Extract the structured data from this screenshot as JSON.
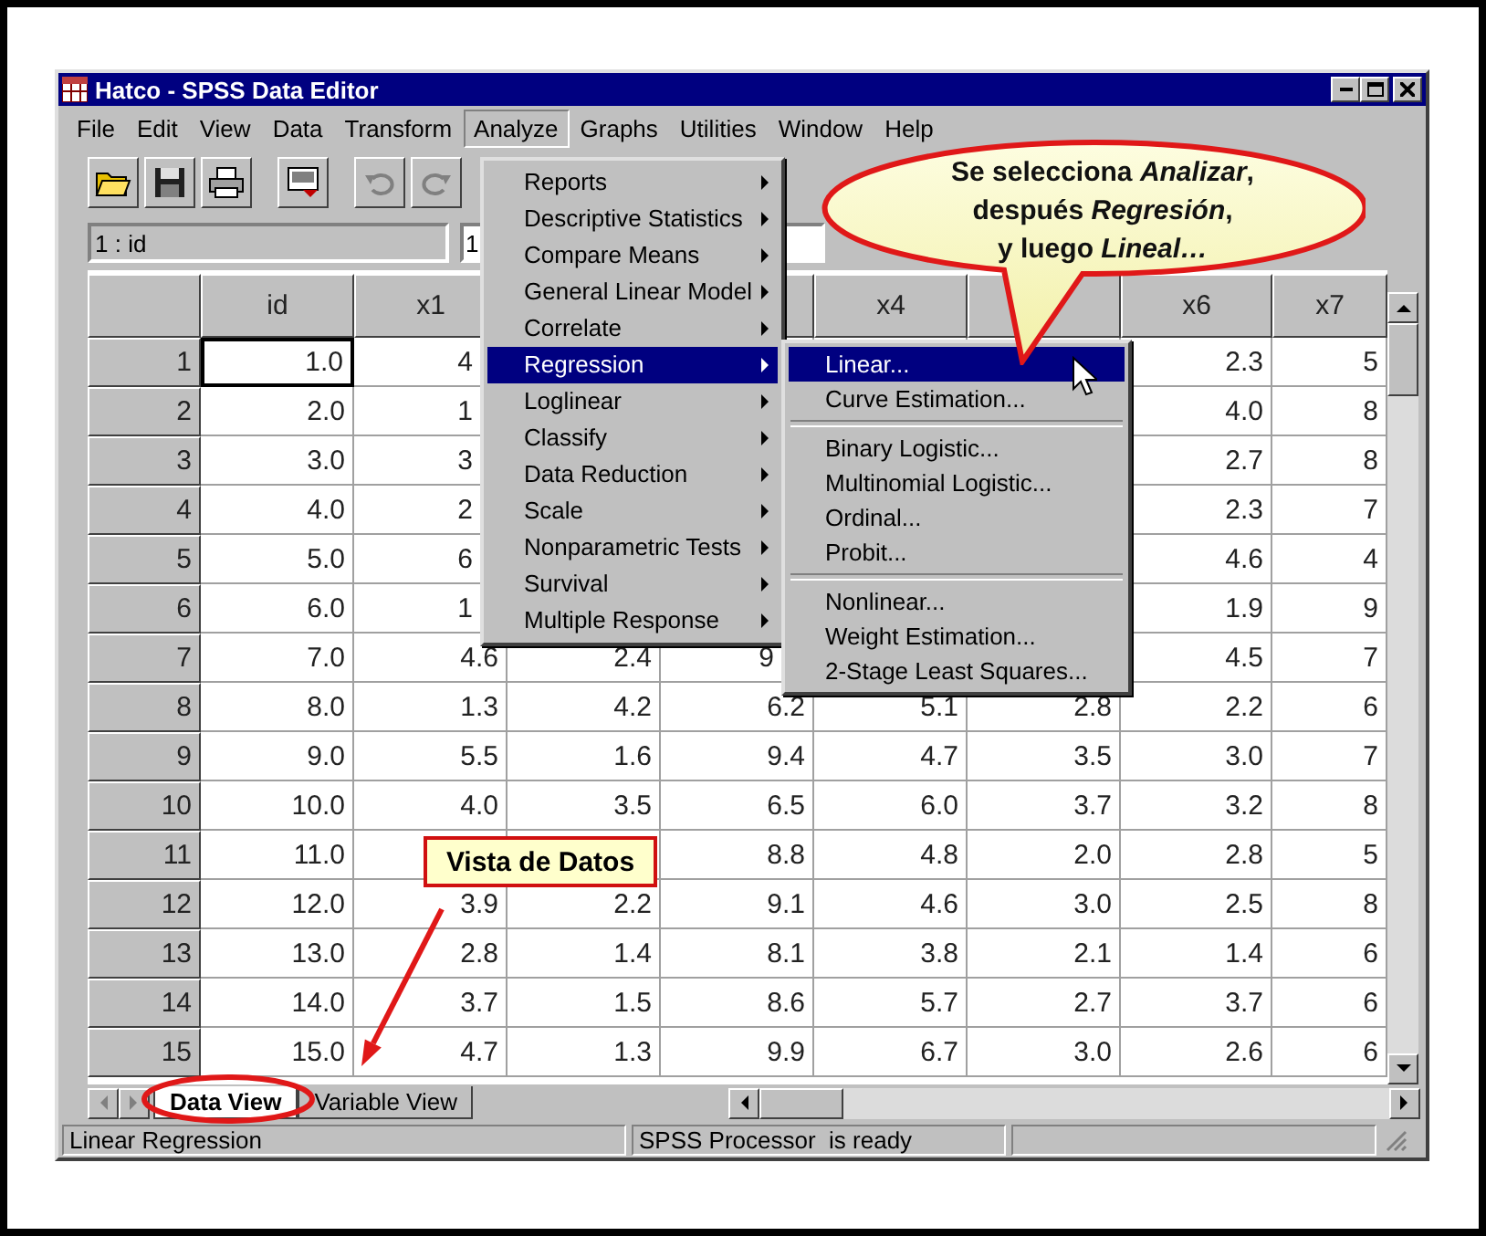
{
  "window": {
    "title": "Hatco - SPSS Data Editor"
  },
  "menu_bar": [
    {
      "label": "File",
      "selected": false
    },
    {
      "label": "Edit",
      "selected": false
    },
    {
      "label": "View",
      "selected": false
    },
    {
      "label": "Data",
      "selected": false
    },
    {
      "label": "Transform",
      "selected": false
    },
    {
      "label": "Analyze",
      "selected": true
    },
    {
      "label": "Graphs",
      "selected": false
    },
    {
      "label": "Utilities",
      "selected": false
    },
    {
      "label": "Window",
      "selected": false
    },
    {
      "label": "Help",
      "selected": false
    }
  ],
  "cell_reference": {
    "name": "1 : id",
    "value": "1"
  },
  "table": {
    "columns": {
      "column_1": "id",
      "column_2": "x1",
      "column_5": "x4",
      "column_7": "x6",
      "column_8": "x7"
    },
    "rows": [
      {
        "number": "1",
        "column_1": "1.0",
        "column_2": "4",
        "column_7": "2.3",
        "column_8": "5"
      },
      {
        "number": "2",
        "column_1": "2.0",
        "column_2": "1",
        "column_7": "4.0",
        "column_8": "8"
      },
      {
        "number": "3",
        "column_1": "3.0",
        "column_2": "3",
        "column_7": "2.7",
        "column_8": "8"
      },
      {
        "number": "4",
        "column_1": "4.0",
        "column_2": "2",
        "column_7": "2.3",
        "column_8": "7"
      },
      {
        "number": "5",
        "column_1": "5.0",
        "column_2": "6",
        "column_7": "4.6",
        "column_8": "4"
      },
      {
        "number": "6",
        "column_1": "6.0",
        "column_2": "1",
        "column_7": "1.9",
        "column_8": "9"
      },
      {
        "number": "7",
        "column_1": "7.0",
        "column_2": "4.6",
        "column_3": "2.4",
        "column_4": "9",
        "column_7": "4.5",
        "column_8": "7"
      },
      {
        "number": "8",
        "column_1": "8.0",
        "column_2": "1.3",
        "column_3": "4.2",
        "column_4": "6.2",
        "column_5": "5.1",
        "column_6": "2.8",
        "column_7": "2.2",
        "column_8": "6"
      },
      {
        "number": "9",
        "column_1": "9.0",
        "column_2": "5.5",
        "column_3": "1.6",
        "column_4": "9.4",
        "column_5": "4.7",
        "column_6": "3.5",
        "column_7": "3.0",
        "column_8": "7"
      },
      {
        "number": "10",
        "column_1": "10.0",
        "column_2": "4.0",
        "column_3": "3.5",
        "column_4": "6.5",
        "column_5": "6.0",
        "column_6": "3.7",
        "column_7": "3.2",
        "column_8": "8"
      },
      {
        "number": "11",
        "column_1": "11.0",
        "column_4": "8.8",
        "column_5": "4.8",
        "column_6": "2.0",
        "column_7": "2.8",
        "column_8": "5"
      },
      {
        "number": "12",
        "column_1": "12.0",
        "column_2": "3.9",
        "column_3": "2.2",
        "column_4": "9.1",
        "column_5": "4.6",
        "column_6": "3.0",
        "column_7": "2.5",
        "column_8": "8"
      },
      {
        "number": "13",
        "column_1": "13.0",
        "column_2": "2.8",
        "column_3": "1.4",
        "column_4": "8.1",
        "column_5": "3.8",
        "column_6": "2.1",
        "column_7": "1.4",
        "column_8": "6"
      },
      {
        "number": "14",
        "column_1": "14.0",
        "column_2": "3.7",
        "column_3": "1.5",
        "column_4": "8.6",
        "column_5": "5.7",
        "column_6": "2.7",
        "column_7": "3.7",
        "column_8": "6"
      },
      {
        "number": "15",
        "column_1": "15.0",
        "column_2": "4.7",
        "column_3": "1.3",
        "column_4": "9.9",
        "column_5": "6.7",
        "column_6": "3.0",
        "column_7": "2.6",
        "column_8": "6"
      }
    ]
  },
  "analyze_menu": [
    {
      "label": "Reports",
      "has_submenu": true,
      "selected": false
    },
    {
      "label": "Descriptive Statistics",
      "has_submenu": true,
      "selected": false
    },
    {
      "label": "Compare Means",
      "has_submenu": true,
      "selected": false
    },
    {
      "label": "General Linear Model",
      "has_submenu": true,
      "selected": false
    },
    {
      "label": "Correlate",
      "has_submenu": true,
      "selected": false
    },
    {
      "label": "Regression",
      "has_submenu": true,
      "selected": true
    },
    {
      "label": "Loglinear",
      "has_submenu": true,
      "selected": false
    },
    {
      "label": "Classify",
      "has_submenu": true,
      "selected": false
    },
    {
      "label": "Data Reduction",
      "has_submenu": true,
      "selected": false
    },
    {
      "label": "Scale",
      "has_submenu": true,
      "selected": false
    },
    {
      "label": "Nonparametric Tests",
      "has_submenu": true,
      "selected": false
    },
    {
      "label": "Survival",
      "has_submenu": true,
      "selected": false
    },
    {
      "label": "Multiple Response",
      "has_submenu": true,
      "selected": false
    }
  ],
  "regression_submenu": [
    [
      {
        "label": "Linear...",
        "selected": true
      },
      {
        "label": "Curve Estimation...",
        "selected": false
      }
    ],
    [
      {
        "label": "Binary Logistic...",
        "selected": false
      },
      {
        "label": "Multinomial Logistic...",
        "selected": false
      },
      {
        "label": "Ordinal...",
        "selected": false
      },
      {
        "label": "Probit...",
        "selected": false
      }
    ],
    [
      {
        "label": "Nonlinear...",
        "selected": false
      },
      {
        "label": "Weight Estimation...",
        "selected": false
      },
      {
        "label": "2-Stage Least Squares...",
        "selected": false
      }
    ]
  ],
  "sheet_tabs": [
    {
      "label": "Data View",
      "selected": true
    },
    {
      "label": "Variable View",
      "selected": false
    }
  ],
  "status_bar": {
    "message": "Linear Regression",
    "processor": "SPSS Processor  is ready"
  },
  "annotations": {
    "balloon": [
      "Se selecciona *Analizar*,",
      "después *Regresión*,",
      "y luego *Lineal…*"
    ],
    "label": "Vista de Datos"
  }
}
